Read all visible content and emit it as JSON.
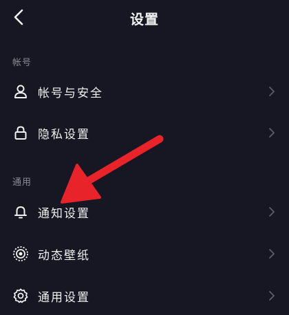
{
  "header": {
    "title": "设置",
    "back_icon": "chevron-left-icon"
  },
  "sections": [
    {
      "label": "帐号",
      "items": [
        {
          "label": "帐号与安全",
          "icon": "person-icon"
        },
        {
          "label": "隐私设置",
          "icon": "lock-icon"
        }
      ]
    },
    {
      "label": "通用",
      "items": [
        {
          "label": "通知设置",
          "icon": "bell-icon"
        },
        {
          "label": "动态壁纸",
          "icon": "live-wallpaper-icon"
        },
        {
          "label": "通用设置",
          "icon": "gear-icon"
        }
      ]
    }
  ],
  "colors": {
    "background": "#161722",
    "text": "#efefef",
    "section_label": "#8a8b94",
    "chevron": "#5d5e68",
    "annotation_arrow": "#e8242a"
  },
  "annotation": {
    "icon": "red-arrow-annotation"
  }
}
